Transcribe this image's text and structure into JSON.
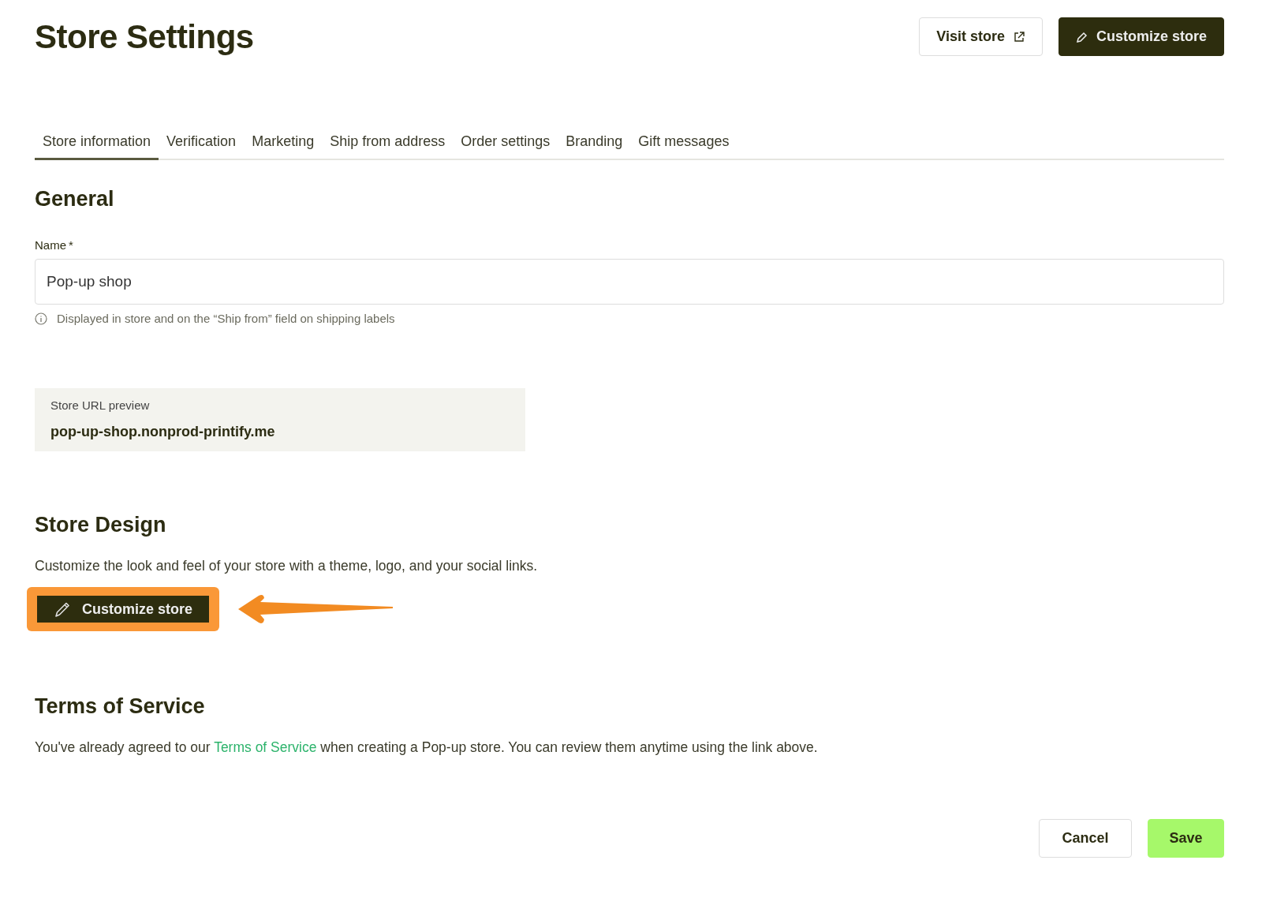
{
  "page_title": "Store Settings",
  "header_buttons": [
    {
      "label": "Visit store",
      "kind": "outline"
    },
    {
      "label": "Customize store",
      "kind": "primary"
    }
  ],
  "tabs": [
    {
      "label": "Store information",
      "selected": true
    },
    {
      "label": "Verification",
      "selected": false
    },
    {
      "label": "Marketing",
      "selected": false
    },
    {
      "label": "Ship from address",
      "selected": false
    },
    {
      "label": "Order settings",
      "selected": false
    },
    {
      "label": "Branding",
      "selected": false
    },
    {
      "label": "Gift messages",
      "selected": false
    }
  ],
  "general": {
    "heading": "General",
    "name_label": "Name",
    "required_mark": "*",
    "name_value": "Pop-up shop",
    "hint": "Displayed in store and on the “Ship from” field on shipping labels",
    "url_label": "Store URL preview",
    "url_value": "pop-up-shop.nonprod-printify.me"
  },
  "design": {
    "heading": "Store Design",
    "text": "Customize the look and feel of your store with a theme, logo, and your social links.",
    "button": "Customize store",
    "highlighted": true
  },
  "terms": {
    "heading": "Terms of Service",
    "before": "You've already agreed to our",
    "link": "Terms of Service",
    "after": "when creating a Pop-up store. You can review them anytime using the link above."
  },
  "footer_buttons": [
    {
      "label": "Cancel",
      "kind": "outline"
    },
    {
      "label": "Save",
      "kind": "accent"
    }
  ]
}
